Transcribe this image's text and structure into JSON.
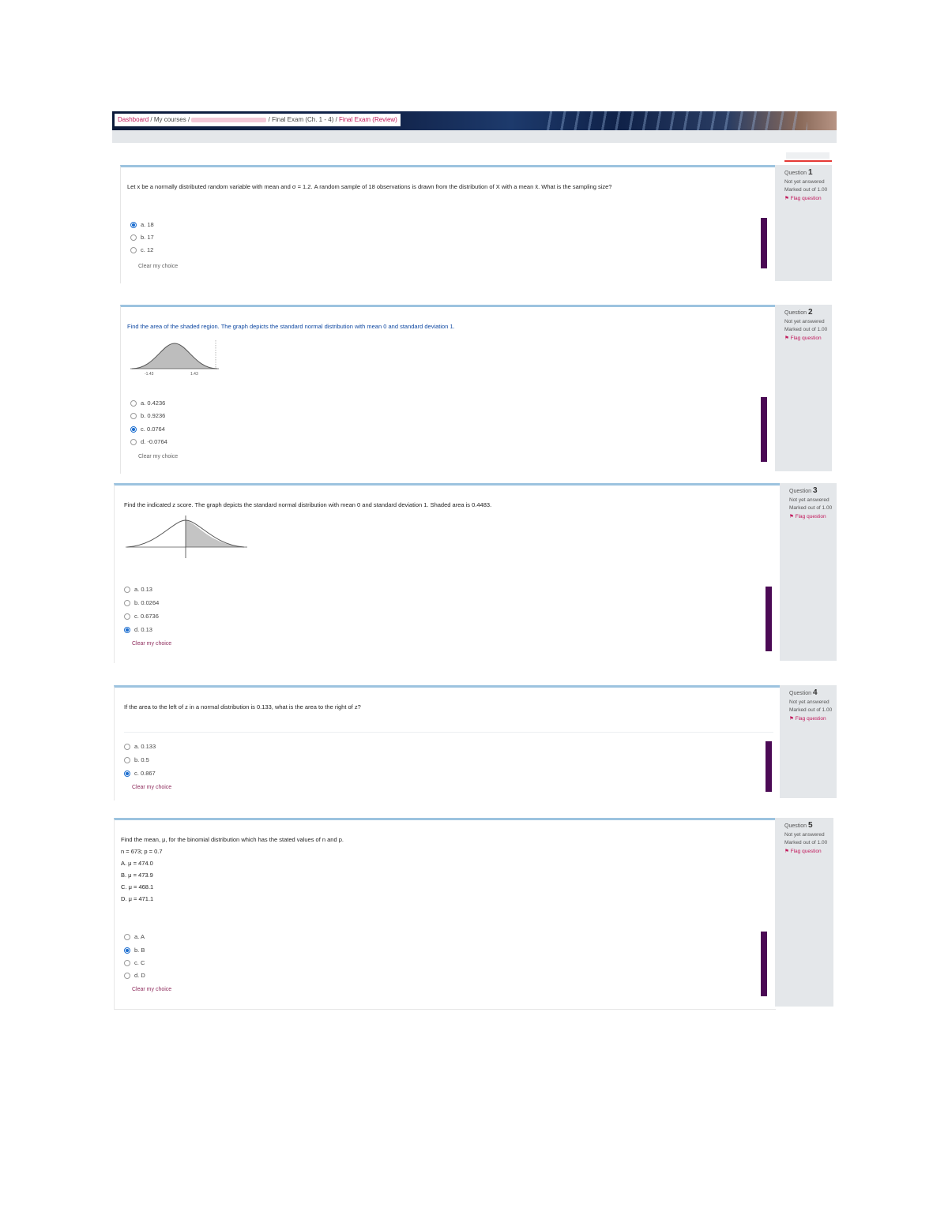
{
  "breadcrumb": {
    "dashboard": "Dashboard",
    "my_courses": "My courses",
    "quiz_path": "Final Exam (Ch. 1 - 4)",
    "review": "Final Exam (Review)"
  },
  "questions": [
    {
      "info": {
        "label": "Question",
        "number": "1",
        "status": "Not yet answered",
        "mark": "Marked out of 1.00",
        "flag": "Flag question"
      },
      "text": "Let x be a normally distributed random variable with mean and σ = 1.2. A random sample of 18 observations is drawn from the distribution of X with a mean x̄. What is the sampling size?",
      "options": [
        {
          "label": "a.",
          "value": "18",
          "checked": true
        },
        {
          "label": "b.",
          "value": "17",
          "checked": false
        },
        {
          "label": "c.",
          "value": "12",
          "checked": false
        }
      ],
      "clear": "Clear my choice"
    },
    {
      "info": {
        "label": "Question",
        "number": "2",
        "status": "Not yet answered",
        "mark": "Marked out of 1.00",
        "flag": "Flag question"
      },
      "text_prefix": "Find the area of the shaded region. The graph depicts the standard normal distribution with mean 0 and standard deviation 1.",
      "options": [
        {
          "label": "a.",
          "value": "0.4236",
          "checked": false
        },
        {
          "label": "b.",
          "value": "0.9236",
          "checked": false
        },
        {
          "label": "c.",
          "value": "0.0764",
          "checked": true
        },
        {
          "label": "d.",
          "value": "-0.0764",
          "checked": false
        }
      ],
      "graph_labels": [
        "-1.43",
        "1.43"
      ],
      "clear": "Clear my choice"
    },
    {
      "info": {
        "label": "Question",
        "number": "3",
        "status": "Not yet answered",
        "mark": "Marked out of 1.00",
        "flag": "Flag question"
      },
      "text": "Find the indicated z score. The graph depicts the standard normal distribution with mean 0 and standard deviation 1. Shaded area is 0.4483.",
      "options": [
        {
          "label": "a.",
          "value": "0.13",
          "checked": false
        },
        {
          "label": "b.",
          "value": "0.0264",
          "checked": false
        },
        {
          "label": "c.",
          "value": "0.6736",
          "checked": false
        },
        {
          "label": "d.",
          "value": "0.13",
          "checked": true
        }
      ],
      "clear": "Clear my choice"
    },
    {
      "info": {
        "label": "Question",
        "number": "4",
        "status": "Not yet answered",
        "mark": "Marked out of 1.00",
        "flag": "Flag question"
      },
      "text": "If the area to the left of z in a normal distribution is 0.133, what is the area to the right of z?",
      "options": [
        {
          "label": "a.",
          "value": "0.133",
          "checked": false
        },
        {
          "label": "b.",
          "value": "0.5",
          "checked": false
        },
        {
          "label": "c.",
          "value": "0.867",
          "checked": true
        }
      ],
      "clear": "Clear my choice"
    },
    {
      "info": {
        "label": "Question",
        "number": "5",
        "status": "Not yet answered",
        "mark": "Marked out of 1.00",
        "flag": "Flag question"
      },
      "text": "Find the mean, μ, for the binomial distribution which has the stated values of n and p.",
      "given": "n = 673; p = 0.7",
      "choices": [
        "A. μ = 474.0",
        "B. μ = 473.9",
        "C. μ = 468.1",
        "D. μ = 471.1"
      ],
      "options": [
        {
          "label": "a.",
          "value": "A",
          "checked": false
        },
        {
          "label": "b.",
          "value": "B",
          "checked": true
        },
        {
          "label": "c.",
          "value": "C",
          "checked": false
        },
        {
          "label": "d.",
          "value": "D",
          "checked": false
        }
      ],
      "clear": "Clear my choice"
    }
  ]
}
